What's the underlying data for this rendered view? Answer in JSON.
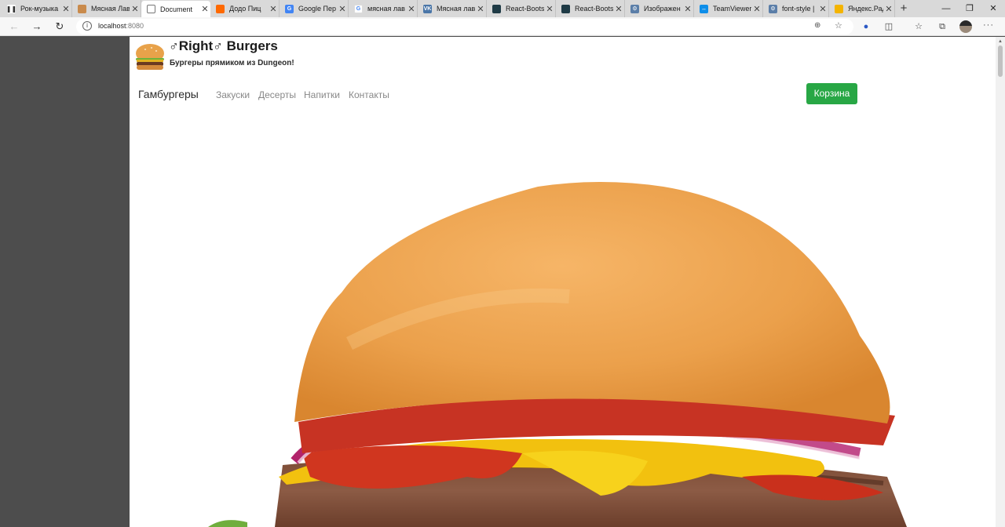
{
  "browser": {
    "tabs": [
      {
        "title": "Рок-музыка",
        "icon": "pause-icon",
        "color": "#333333"
      },
      {
        "title": "Мясная Лав",
        "icon": "burger-favicon",
        "color": "#b5651d"
      },
      {
        "title": "Document",
        "icon": "page-icon",
        "color": "#666666"
      },
      {
        "title": "Додо Пиц",
        "icon": "dodo-icon",
        "color": "#ff6900"
      },
      {
        "title": "Google Пер",
        "icon": "translate-icon",
        "color": "#4285f4"
      },
      {
        "title": "мясная лав",
        "icon": "google-icon",
        "color": "#4285f4"
      },
      {
        "title": "Мясная лав",
        "icon": "vk-icon",
        "color": "#4a76a8"
      },
      {
        "title": "React-Boots",
        "icon": "react-bootstrap-icon",
        "color": "#1f3b46"
      },
      {
        "title": "React-Boots",
        "icon": "react-bootstrap-icon",
        "color": "#1f3b46"
      },
      {
        "title": "Изображен",
        "icon": "gear-icon",
        "color": "#5b7ea8"
      },
      {
        "title": "TeamViewer",
        "icon": "teamviewer-icon",
        "color": "#0e8ee9"
      },
      {
        "title": "font-style |",
        "icon": "gear-icon",
        "color": "#5b7ea8"
      },
      {
        "title": "Яндекс.Рад",
        "icon": "yandex-icon",
        "color": "#f4b400"
      }
    ],
    "new_tab": "+",
    "url_host": "localhost",
    "url_port": ":8080"
  },
  "site": {
    "brand": "♂Right♂ Burgers",
    "tagline": "Бургеры прямиком из Dungeon!",
    "nav": {
      "active": "Гамбургеры",
      "links": [
        "Закуски",
        "Десерты",
        "Напитки",
        "Контакты"
      ]
    },
    "cart_label": "Корзина",
    "cart_color": "#28a745"
  }
}
